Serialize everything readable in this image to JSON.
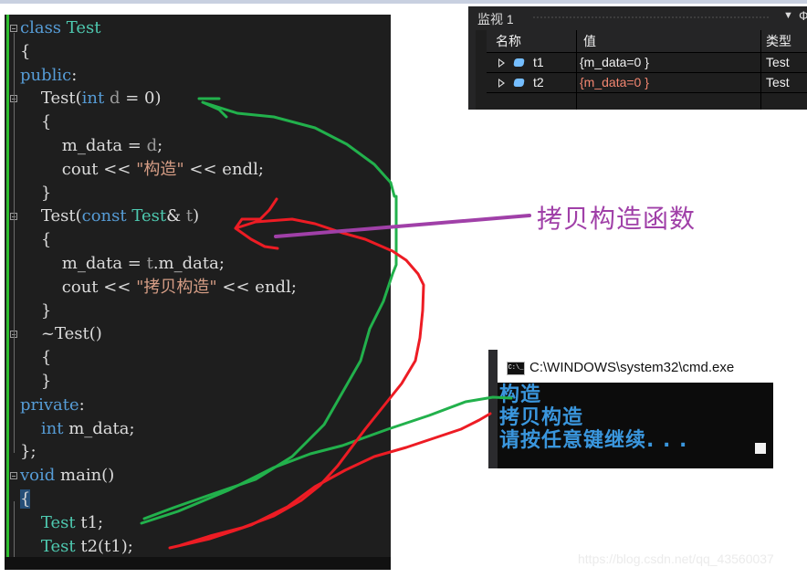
{
  "editor": {
    "lines": [
      {
        "parts": [
          [
            "kw",
            "class"
          ],
          [
            "",
            ""
          ],
          [
            "ty",
            " Test"
          ]
        ]
      },
      {
        "parts": [
          [
            "",
            "{"
          ]
        ]
      },
      {
        "parts": [
          [
            "kw",
            "public"
          ],
          [
            "",
            ":"
          ]
        ]
      },
      {
        "parts": [
          [
            "",
            "    Test("
          ],
          [
            "kw",
            "int"
          ],
          [
            "pm",
            " d"
          ],
          [
            "",
            " = 0)"
          ]
        ]
      },
      {
        "parts": [
          [
            "",
            "    {"
          ]
        ]
      },
      {
        "parts": [
          [
            "",
            "        m_data = "
          ],
          [
            "pm",
            "d"
          ],
          [
            "",
            ";"
          ]
        ]
      },
      {
        "parts": [
          [
            "",
            "        cout << "
          ],
          [
            "st",
            "\"构造\""
          ],
          [
            "",
            " << endl;"
          ]
        ]
      },
      {
        "parts": [
          [
            "",
            "    }"
          ]
        ]
      },
      {
        "parts": [
          [
            "",
            "    Test("
          ],
          [
            "kw",
            "const"
          ],
          [
            "ty",
            " Test"
          ],
          [
            "",
            "&"
          ],
          [
            "pm",
            " t"
          ],
          [
            "",
            ")"
          ]
        ]
      },
      {
        "parts": [
          [
            "",
            "    {"
          ]
        ]
      },
      {
        "parts": [
          [
            "",
            "        m_data = "
          ],
          [
            "pm",
            "t"
          ],
          [
            "",
            ".m_data;"
          ]
        ]
      },
      {
        "parts": [
          [
            "",
            "        cout << "
          ],
          [
            "st",
            "\"拷贝构造\""
          ],
          [
            "",
            " << endl;"
          ]
        ]
      },
      {
        "parts": [
          [
            "",
            "    }"
          ]
        ]
      },
      {
        "parts": [
          [
            "",
            "    ~Test()"
          ]
        ]
      },
      {
        "parts": [
          [
            "",
            "    {"
          ]
        ]
      },
      {
        "parts": [
          [
            "",
            "    }"
          ]
        ]
      },
      {
        "parts": [
          [
            "kw",
            "private"
          ],
          [
            "",
            ":"
          ]
        ]
      },
      {
        "parts": [
          [
            "kw",
            "    int"
          ],
          [
            "",
            " m_data;"
          ]
        ]
      },
      {
        "parts": [
          [
            "",
            "};"
          ]
        ]
      },
      {
        "parts": [
          [
            "kw",
            "void"
          ],
          [
            "",
            " main()"
          ]
        ]
      },
      {
        "parts": [
          [
            "hl",
            "{"
          ]
        ]
      },
      {
        "parts": [
          [
            "ty",
            "    Test"
          ],
          [
            "",
            " t1;"
          ]
        ]
      },
      {
        "parts": [
          [
            "ty",
            "    Test"
          ],
          [
            "",
            " t2(t1);"
          ]
        ]
      }
    ]
  },
  "watch": {
    "title": "监视 1",
    "menu_icon": "▼",
    "pin_icon": "Ф",
    "columns": [
      "名称",
      "值",
      "类型"
    ],
    "rows": [
      {
        "name": "t1",
        "value": "{m_data=0 }",
        "type": "Test",
        "changed": false
      },
      {
        "name": "t2",
        "value": "{m_data=0 }",
        "type": "Test",
        "changed": true
      }
    ],
    "value_color": "#f1f1f1",
    "changed_color": "#f48771"
  },
  "console": {
    "title": "C:\\WINDOWS\\system32\\cmd.exe",
    "icon_text": "C:\\_",
    "lines": [
      "构造",
      "拷贝构造",
      "请按任意键继续. . ."
    ]
  },
  "annotation": {
    "label": "拷贝构造函数",
    "color": "#a040a8"
  },
  "watermark": "https://blog.csdn.net/qq_43560037"
}
